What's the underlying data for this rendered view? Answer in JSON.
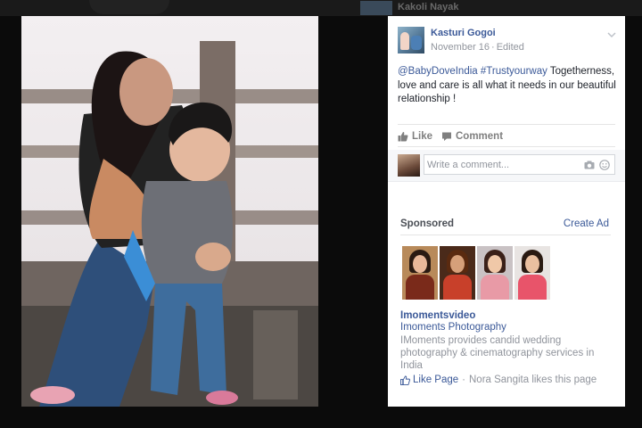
{
  "background": {
    "behind_name": "Kakoli Nayak"
  },
  "post": {
    "author": "Kasturi Gogoi",
    "date": "November 16",
    "separator": "·",
    "edited": "Edited",
    "text_mention": "@BabyDoveIndia",
    "text_hashtag": "#Trustyourway",
    "text_body": " Togetherness, love and care is all what it needs in our beautiful relationship !",
    "menu_icon": "chevron-down-icon"
  },
  "actions": {
    "like_label": "Like",
    "comment_label": "Comment"
  },
  "comment": {
    "placeholder": "Write a comment..."
  },
  "sponsored": {
    "heading": "Sponsored",
    "create_ad": "Create Ad",
    "ad": {
      "title": "Imomentsvideo",
      "subtitle": "Imoments Photography",
      "description": "IMoments provides candid wedding photography & cinematography services in India",
      "like_page": "Like Page",
      "dot": "·",
      "social": "Nora Sangita likes this page"
    }
  },
  "colors": {
    "link": "#3b5998",
    "muted": "#90949c",
    "text": "#1d2129"
  }
}
